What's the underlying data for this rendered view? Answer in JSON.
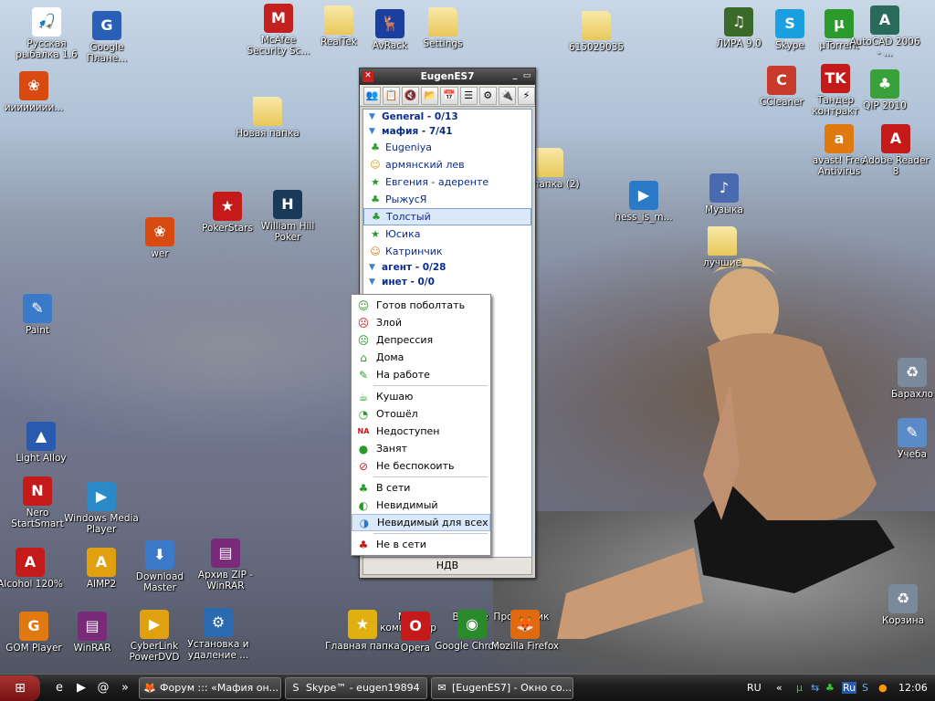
{
  "desktop": {
    "icons": [
      {
        "label": "Русская рыбалка 1.6",
        "glyph": "🎣",
        "bg": "#ffffff"
      },
      {
        "label": "Google Плане...",
        "glyph": "G",
        "bg": "#2a5fb8"
      },
      {
        "label": "McAfee Security Sc...",
        "glyph": "M",
        "bg": "#c42020"
      },
      {
        "label": "RealTek",
        "glyph": "",
        "bg": "folder"
      },
      {
        "label": "AvRack",
        "glyph": "🦌",
        "bg": "#1a3fa0"
      },
      {
        "label": "Settings",
        "glyph": "",
        "bg": "folder"
      },
      {
        "label": "615029035",
        "glyph": "",
        "bg": "folder"
      },
      {
        "label": "ЛИРА 9.0",
        "glyph": "♫",
        "bg": "#3a6a2a"
      },
      {
        "label": "Skype",
        "glyph": "S",
        "bg": "#1aa0e0"
      },
      {
        "label": "µTorrent",
        "glyph": "µ",
        "bg": "#2a9a2a"
      },
      {
        "label": "AutoCAD 2006 - ...",
        "glyph": "A",
        "bg": "#2a6a5a"
      },
      {
        "label": "ииииииии...",
        "glyph": "❀",
        "bg": "#d84a10"
      },
      {
        "label": "Новая папка",
        "glyph": "",
        "bg": "folder"
      },
      {
        "label": "CCleaner",
        "glyph": "C",
        "bg": "#c83a2a"
      },
      {
        "label": "Тандер контракт",
        "glyph": "TK",
        "bg": "#c41a1a"
      },
      {
        "label": "QIP 2010",
        "glyph": "♣",
        "bg": "#3aa03a"
      },
      {
        "label": "ая папка (2)",
        "glyph": "",
        "bg": "folder"
      },
      {
        "label": "hess_is_m...",
        "glyph": "▶",
        "bg": "#2a7ac8"
      },
      {
        "label": "Музыка",
        "glyph": "♪",
        "bg": "#4a6ab0"
      },
      {
        "label": "avast! Free Antivirus",
        "glyph": "a",
        "bg": "#e07a10"
      },
      {
        "label": "Adobe Reader 8",
        "glyph": "A",
        "bg": "#c41a1a"
      },
      {
        "label": "PokerStars",
        "glyph": "★",
        "bg": "#c41a1a"
      },
      {
        "label": "William Hill Poker",
        "glyph": "H",
        "bg": "#1a3a5a"
      },
      {
        "label": "wer",
        "glyph": "❀",
        "bg": "#d84a10"
      },
      {
        "label": "лучшие",
        "glyph": "",
        "bg": "folder"
      },
      {
        "label": "Paint",
        "glyph": "✎",
        "bg": "#3a7ac8"
      },
      {
        "label": "Барахло",
        "glyph": "♻",
        "bg": "#7a8a9a"
      },
      {
        "label": "Light Alloy",
        "glyph": "▲",
        "bg": "#2a5ab0"
      },
      {
        "label": "Учеба",
        "glyph": "✎",
        "bg": "#5a8ac8"
      },
      {
        "label": "Nero StartSmart",
        "glyph": "N",
        "bg": "#c41a1a"
      },
      {
        "label": "Windows Media Player",
        "glyph": "▶",
        "bg": "#2a8ac8"
      },
      {
        "label": "Alcohol 120%",
        "glyph": "A",
        "bg": "#c41a1a"
      },
      {
        "label": "AIMP2",
        "glyph": "A",
        "bg": "#e0a010"
      },
      {
        "label": "Download Master",
        "glyph": "⬇",
        "bg": "#3a7ac8"
      },
      {
        "label": "Архив ZIP - WinRAR",
        "glyph": "▤",
        "bg": "#7a2a7a"
      },
      {
        "label": "Мой компьютер",
        "glyph": "",
        "bg": "none"
      },
      {
        "label": "Beeline",
        "glyph": "",
        "bg": "none"
      },
      {
        "label": "Проводник",
        "glyph": "",
        "bg": "none"
      },
      {
        "label": "Корзина",
        "glyph": "♻",
        "bg": "#7a8a9a"
      },
      {
        "label": "GOM Player",
        "glyph": "G",
        "bg": "#e07a10"
      },
      {
        "label": "WinRAR",
        "glyph": "▤",
        "bg": "#7a2a7a"
      },
      {
        "label": "CyberLink PowerDVD",
        "glyph": "▶",
        "bg": "#e0a010"
      },
      {
        "label": "Установка и удаление ...",
        "glyph": "⚙",
        "bg": "#2a6ab0"
      },
      {
        "label": "Главная папка",
        "glyph": "★",
        "bg": "#e0b010"
      },
      {
        "label": "Opera",
        "glyph": "O",
        "bg": "#c41a1a"
      },
      {
        "label": "Google Chrome",
        "glyph": "◉",
        "bg": "#2a8a2a"
      },
      {
        "label": "Mozilla Firefox",
        "glyph": "🦊",
        "bg": "#e06a10"
      }
    ],
    "wallpaper_tag": "⇱"
  },
  "qip": {
    "title": "EugenES7",
    "close_glyph": "✕",
    "min_glyph": "▭",
    "toolbar": [
      "👥",
      "📋",
      "🔇",
      "📂",
      "📅",
      "☰",
      "⚙",
      "🔌",
      "⚡"
    ],
    "contacts": [
      {
        "type": "group",
        "label": "General - 0/13"
      },
      {
        "type": "group",
        "label": "мафия - 7/41"
      },
      {
        "type": "contact",
        "label": "Eugeniya",
        "icon": "♣",
        "color": "#2a9a2a"
      },
      {
        "type": "contact",
        "label": "армянский лев",
        "icon": "☺",
        "color": "#e0a010"
      },
      {
        "type": "contact",
        "label": "Евгения - адеренте",
        "icon": "★",
        "color": "#2a9a2a"
      },
      {
        "type": "contact",
        "label": "РыжусЯ",
        "icon": "♣",
        "color": "#2a9a2a"
      },
      {
        "type": "contact",
        "label": "Толстый",
        "icon": "♣",
        "color": "#2a9a2a",
        "selected": true
      },
      {
        "type": "contact",
        "label": "Юсика",
        "icon": "★",
        "color": "#2a9a2a"
      },
      {
        "type": "contact",
        "label": "Катринчик",
        "icon": "☺",
        "color": "#e07a10"
      },
      {
        "type": "group",
        "label": "агент - 0/28"
      },
      {
        "type": "group",
        "label": "инет - 0/0"
      }
    ],
    "status_label": "НДВ"
  },
  "status_menu": {
    "items": [
      {
        "label": "Готов поболтать",
        "icon": "☺",
        "color": "#2a9a2a"
      },
      {
        "label": "Злой",
        "icon": "☹",
        "color": "#c41a1a"
      },
      {
        "label": "Депрессия",
        "icon": "☹",
        "color": "#2a9a2a"
      },
      {
        "label": "Дома",
        "icon": "⌂",
        "color": "#2a9a2a"
      },
      {
        "label": "На работе",
        "icon": "✎",
        "color": "#2a9a2a"
      },
      {
        "sep": true
      },
      {
        "label": "Кушаю",
        "icon": "☕",
        "color": "#2a9a2a"
      },
      {
        "label": "Отошёл",
        "icon": "◔",
        "color": "#2a9a2a"
      },
      {
        "label": "Недоступен",
        "icon": "NA",
        "color": "#c41a1a"
      },
      {
        "label": "Занят",
        "icon": "●",
        "color": "#2a9a2a"
      },
      {
        "label": "Не беспокоить",
        "icon": "⊘",
        "color": "#c41a1a"
      },
      {
        "sep": true
      },
      {
        "label": "В сети",
        "icon": "♣",
        "color": "#2a9a2a"
      },
      {
        "label": "Невидимый",
        "icon": "◐",
        "color": "#2a9a2a"
      },
      {
        "label": "Невидимый для всех",
        "icon": "◑",
        "color": "#2a7ac8",
        "highlighted": true
      },
      {
        "sep": true
      },
      {
        "label": "Не в сети",
        "icon": "♣",
        "color": "#c41a1a"
      }
    ]
  },
  "taskbar": {
    "start_glyph": "⊞",
    "quicklaunch": [
      "e",
      "▶",
      "@",
      "»"
    ],
    "tasks": [
      {
        "label": "Форум ::: «Мафия он...",
        "icon": "🦊"
      },
      {
        "label": "Skype™ - eugen19894",
        "icon": "S"
      },
      {
        "label": "[EugenES7] - Окно со...",
        "icon": "✉"
      }
    ],
    "lang": "RU",
    "tray_chevron": "«",
    "tray_lang2": "Ru",
    "clock": "12:06"
  }
}
